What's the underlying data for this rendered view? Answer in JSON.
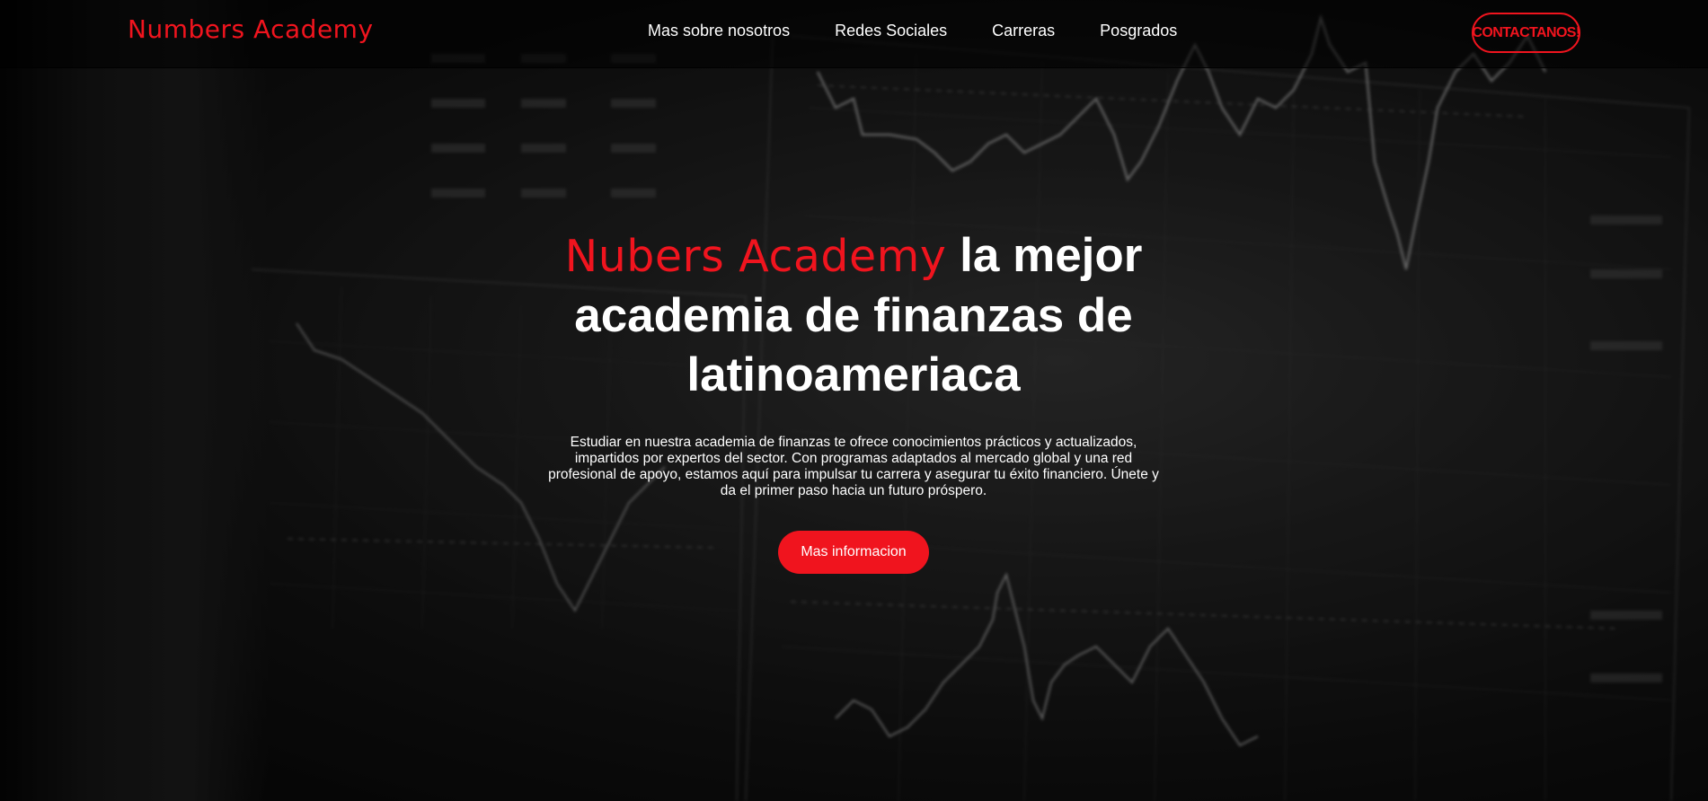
{
  "navbar": {
    "brand": "Numbers Academy",
    "links": [
      {
        "label": "Mas sobre nosotros"
      },
      {
        "label": "Redes Sociales"
      },
      {
        "label": "Carreras"
      },
      {
        "label": "Posgrados"
      }
    ],
    "contact_label": "CONTACTANOS!"
  },
  "hero": {
    "headline_accent": "Nubers Academy",
    "headline_rest": " la mejor academia de finanzas de latinoameriaca",
    "lead": "Estudiar en nuestra academia de finanzas te ofrece conocimientos prácticos y actualizados, impartidos por expertos del sector. Con programas adaptados al mercado global y una red profesional de apoyo, estamos aquí para impulsar tu carrera y asegurar tu éxito financiero. Únete y da el primer paso hacia un futuro próspero.",
    "cta_label": "Mas informacion"
  },
  "colors": {
    "accent": "#f0141e",
    "text": "#ffffff",
    "background": "#141414"
  }
}
